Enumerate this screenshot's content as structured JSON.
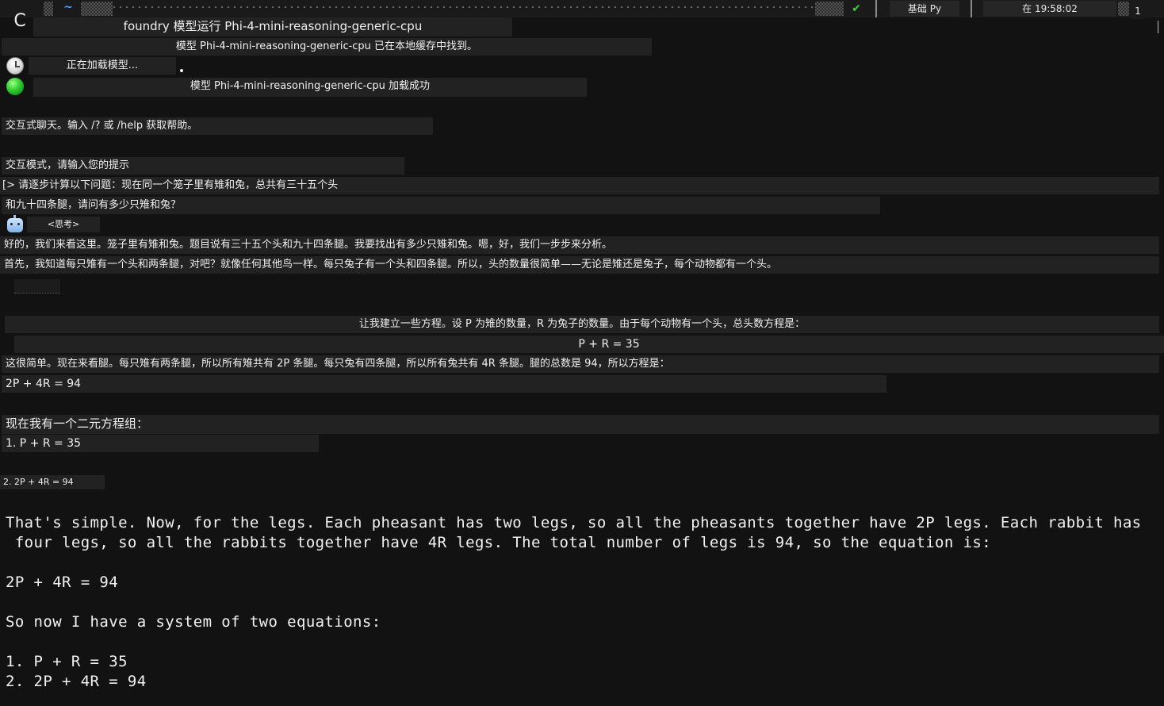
{
  "status_bar": {
    "checkmark": "✔",
    "segment_env": "基础 Py",
    "segment_time": "在 19:58:02",
    "segment_count": "1",
    "app_glyph": "C"
  },
  "terminal_lines": {
    "command": "foundry 模型运行 Phi-4-mini-reasoning-generic-cpu",
    "cache_found": "模型 Phi-4-mini-reasoning-generic-cpu 已在本地缓存中找到。",
    "loading": "正在加载模型...",
    "loaded": "模型 Phi-4-mini-reasoning-generic-cpu 加载成功",
    "interactive_help": "交互式聊天。输入 /? 或 /help 获取帮助。",
    "interactive_prompt": "交互模式，请输入您的提示",
    "user_prompt_1": "[> 请逐步计算以下问题：现在同一个笼子里有雉和兔，总共有三十五个头",
    "user_prompt_2": "和九十四条腿，请问有多少只雉和兔？",
    "think_tag": "<思考>",
    "resp_1": "好的，我们来看这里。笼子里有雉和兔。题目说有三十五个头和九十四条腿。我要找出有多少只雉和兔。嗯，好，我们一步步来分析。",
    "resp_2": "首先，我知道每只雉有一个头和两条腿，对吧？就像任何其他鸟一样。每只兔子有一个头和四条腿。所以，头的数量很简单——无论是雉还是兔子，每个动物都有一个头。",
    "resp_3": "让我建立一些方程。设 P 为雉的数量，R 为兔子的数量。由于每个动物有一个头，总头数方程是：",
    "eq_heads": "P + R = 35",
    "resp_4": "这很简单。现在来看腿。每只雉有两条腿，所以所有雉共有 2P 条腿。每只兔有四条腿，所以所有兔共有 4R 条腿。腿的总数是 94，所以方程是：",
    "eq_legs": "2P + 4R = 94",
    "system_intro": "现在我有一个二元方程组：",
    "sys_1": "1. P + R = 35",
    "sys_2": "2. 2P + 4R = 94"
  },
  "english_output": {
    "line_1": "That's simple. Now, for the legs. Each pheasant has two legs, so all the pheasants together have 2P legs. Each rabbit has",
    "line_2": " four legs, so all the rabbits together have 4R legs. The total number of legs is 94, so the equation is:",
    "line_3": "2P + 4R = 94",
    "line_4": "So now I have a system of two equations:",
    "line_5": "1. P + R = 35",
    "line_6": "2. 2P + 4R = 94"
  }
}
